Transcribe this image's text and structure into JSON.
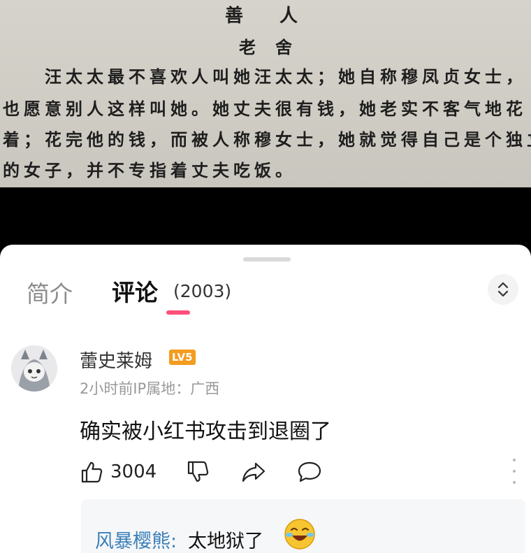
{
  "book": {
    "title": "善人",
    "author": "老舍",
    "lines": [
      "汪太太最不喜欢人叫她汪太太；她自称穆凤贞女士，",
      "也愿意别人这样叫她。她丈夫很有钱，她老实不客气地花",
      "着；花完他的钱，而被人称穆女士，她就觉得自己是个独立",
      "的女子，并不专指着丈夫吃饭。"
    ]
  },
  "tabs": {
    "intro_label": "简介",
    "comments_label": "评论",
    "comments_count": "(2003)"
  },
  "comment": {
    "username": "蕾史莱姆",
    "level": "LV5",
    "meta": "2小时前IP属地：广西",
    "text": "确实被小红书攻击到退圈了",
    "like_count": "3004",
    "icons": [
      "thumbs-up-icon",
      "thumbs-down-icon",
      "share-icon",
      "comment-bubble-icon",
      "more-icon"
    ]
  },
  "reply": {
    "username": "风暴樱熊:",
    "text": "太地狱了",
    "emoji": "crying-laughing-emoji"
  },
  "colors": {
    "accent": "#ff4f7a",
    "reply_user": "#3a7fb8",
    "badge": "#f39c1e"
  }
}
